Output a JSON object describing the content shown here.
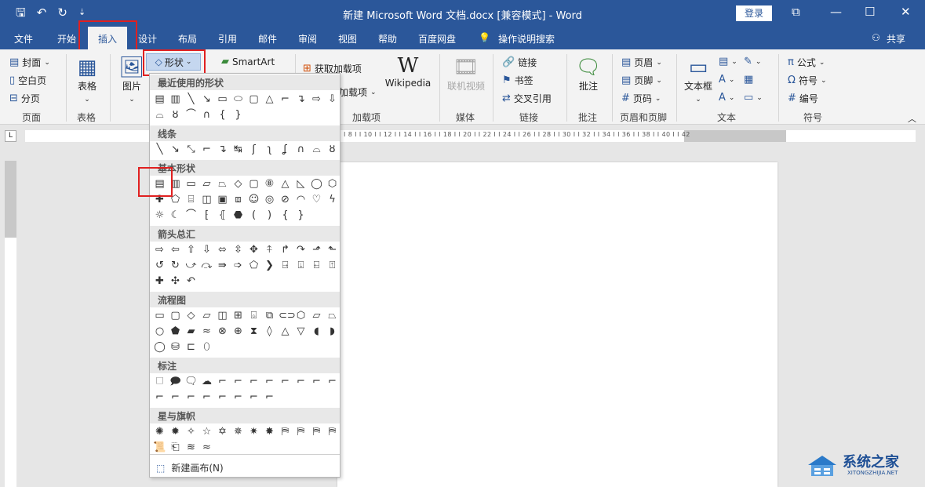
{
  "titlebar": {
    "qat_icons": [
      "save-icon",
      "undo-icon",
      "redo-icon",
      "customize-icon"
    ],
    "save": "🖫",
    "undo": "↶",
    "redo": "↻",
    "customize": "⇣",
    "title": "新建 Microsoft Word 文档.docx [兼容模式] - Word",
    "login": "登录",
    "restore_icon": "⧉",
    "minimize": "—",
    "maximize": "☐",
    "close": "✕"
  },
  "tabs": {
    "file": "文件",
    "home": "开始",
    "insert": "插入",
    "design": "设计",
    "layout": "布局",
    "references": "引用",
    "mailings": "邮件",
    "review": "审阅",
    "view": "视图",
    "help": "帮助",
    "baidu": "百度网盘",
    "tellme": "操作说明搜索",
    "share": "共享"
  },
  "ribbon": {
    "cover": "封面",
    "blank_page": "空白页",
    "page_break": "分页",
    "pages_group": "页面",
    "table": "表格",
    "table_group": "表格",
    "picture": "图片",
    "shapes": "形状",
    "smartart": "SmartArt",
    "get_addins": "获取加载项",
    "my_addins": "加载项",
    "wikipedia": "Wikipedia",
    "addins_group": "加载项",
    "online_video": "联机视频",
    "media_group": "媒体",
    "link": "链接",
    "bookmark": "书签",
    "cross_ref": "交叉引用",
    "links_group": "链接",
    "comment": "批注",
    "comments_group": "批注",
    "header": "页眉",
    "footer": "页脚",
    "page_number": "页码",
    "hf_group": "页眉和页脚",
    "textbox": "文本框",
    "text_group": "文本",
    "equation": "公式",
    "symbol": "符号",
    "numbering": "编号",
    "symbols_group": "符号"
  },
  "ruler": {
    "numbers": "I 8 I  I 10 I  I 12 I  I 14 I  I 16 I  I 18 I  I 20 I  I 22 I  I 24 I  I 26 I  I 28 I  I 30 I  I 32 I  I 34 I  I 36 I  I 38 I  I 40 I  I 42",
    "corner": "L"
  },
  "shapes_menu": {
    "recent": "最近使用的形状",
    "lines": "线条",
    "basic": "基本形状",
    "arrows": "箭头总汇",
    "flowchart": "流程图",
    "callouts": "标注",
    "stars": "星与旗帜",
    "new_canvas": "新建画布(N)"
  },
  "watermark": {
    "big": "系统之家",
    "small": "XITONGZHIJIA.NET"
  }
}
